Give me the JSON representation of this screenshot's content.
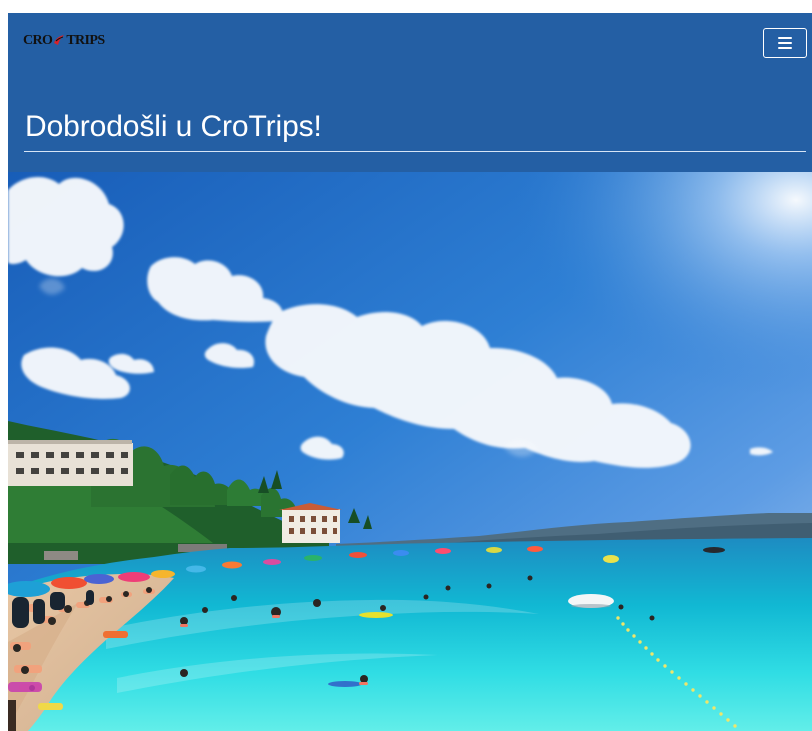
{
  "header": {
    "brand": {
      "part1": "CRO",
      "part2": "TRIPS"
    },
    "title": "Dobrodošli u CroTrips!",
    "menu_icon": "hamburger-menu-icon"
  },
  "hero": {
    "image_subject": "beach-photo"
  },
  "colors": {
    "header_bg": "#245fa4",
    "text": "#ffffff",
    "sea": "#1ecbe0",
    "sky": "#2b79c7"
  }
}
